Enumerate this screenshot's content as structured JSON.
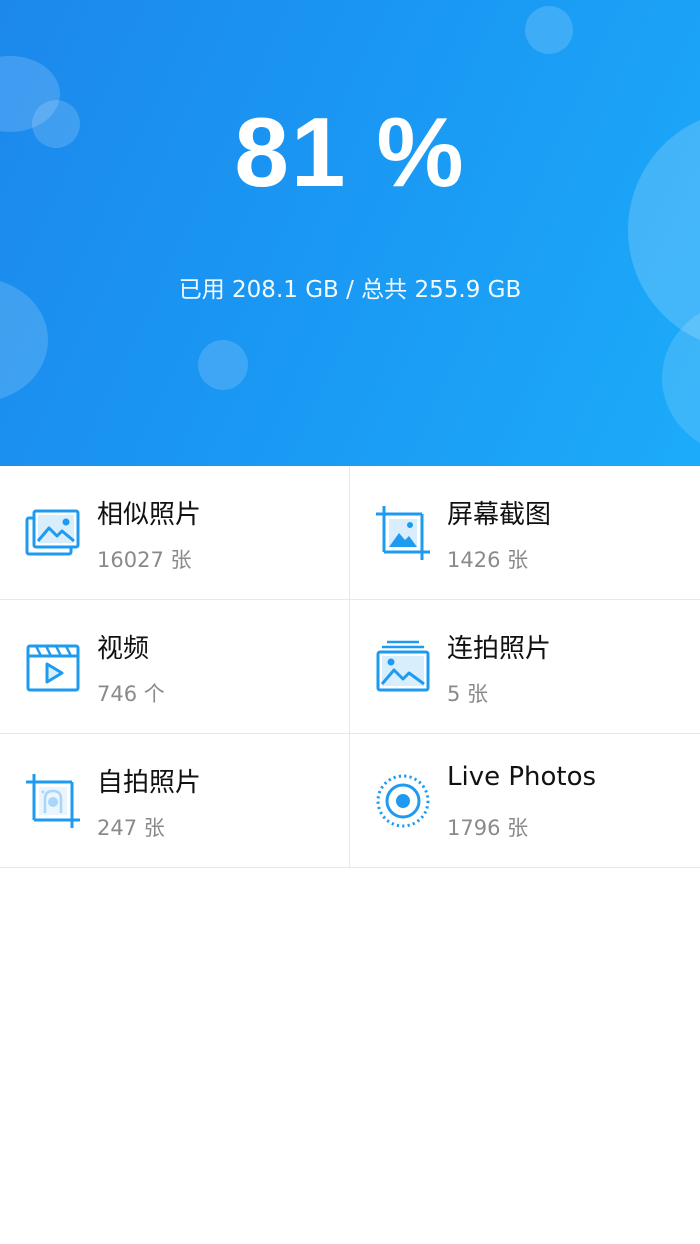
{
  "storage": {
    "percent": "81 %",
    "usage_text": "已用 208.1 GB / 总共 255.9 GB"
  },
  "colors": {
    "accent": "#1e9bf0",
    "header_start": "#1c88ec",
    "header_end": "#1cabfa"
  },
  "categories": [
    {
      "title": "相似照片",
      "count": "16027 张",
      "icon": "similar-photos-icon"
    },
    {
      "title": "屏幕截图",
      "count": "1426 张",
      "icon": "screenshot-icon"
    },
    {
      "title": "视频",
      "count": "746 个",
      "icon": "video-icon"
    },
    {
      "title": "连拍照片",
      "count": "5 张",
      "icon": "burst-photos-icon"
    },
    {
      "title": "自拍照片",
      "count": "247 张",
      "icon": "selfie-icon"
    },
    {
      "title": "Live Photos",
      "count": "1796 张",
      "icon": "live-photos-icon"
    }
  ]
}
